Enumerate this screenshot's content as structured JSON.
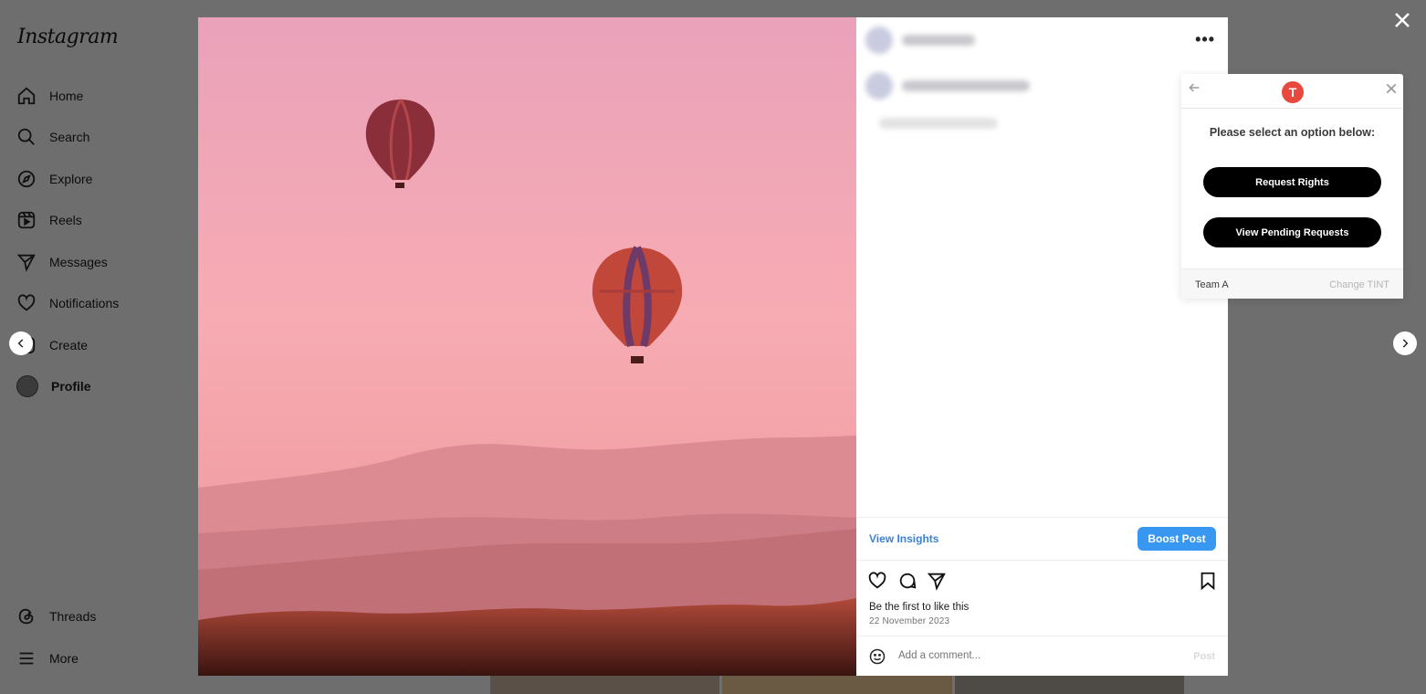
{
  "sidebar": {
    "logo": "Instagram",
    "items": [
      {
        "label": "Home",
        "icon": "home-icon"
      },
      {
        "label": "Search",
        "icon": "search-icon"
      },
      {
        "label": "Explore",
        "icon": "compass-icon"
      },
      {
        "label": "Reels",
        "icon": "reels-icon"
      },
      {
        "label": "Messages",
        "icon": "send-icon"
      },
      {
        "label": "Notifications",
        "icon": "heart-icon"
      },
      {
        "label": "Create",
        "icon": "plus-icon"
      },
      {
        "label": "Profile",
        "icon": "avatar"
      }
    ],
    "bottom": [
      {
        "label": "Threads",
        "icon": "threads-icon"
      },
      {
        "label": "More",
        "icon": "menu-icon"
      }
    ]
  },
  "post": {
    "view_insights": "View Insights",
    "boost_post": "Boost Post",
    "likes_text": "Be the first to like this",
    "date": "22 November 2023",
    "comment_placeholder": "Add a comment...",
    "post_label": "Post"
  },
  "tint": {
    "logo_letter": "T",
    "prompt": "Please select an option below:",
    "request_rights": "Request Rights",
    "view_pending": "View Pending Requests",
    "team": "Team A",
    "change_tint": "Change TINT"
  },
  "colors": {
    "accent": "#3897f0",
    "tint_brand": "#e8493e",
    "overlay": "#6e6e6e"
  }
}
